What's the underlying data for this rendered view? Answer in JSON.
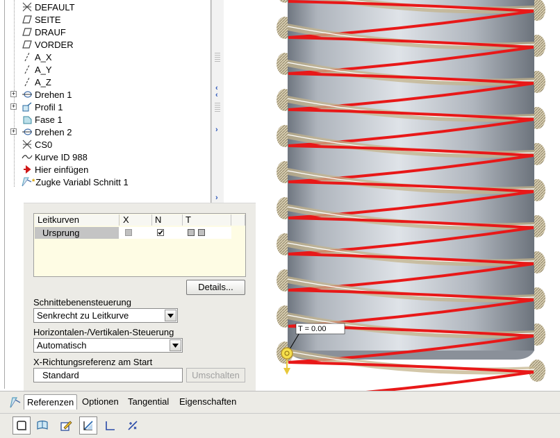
{
  "model_tree": {
    "items": [
      {
        "label": "DEFAULT",
        "icon": "coordinate-system-icon"
      },
      {
        "label": "SEITE",
        "icon": "datum-plane-icon"
      },
      {
        "label": "DRAUF",
        "icon": "datum-plane-icon"
      },
      {
        "label": "VORDER",
        "icon": "datum-plane-icon"
      },
      {
        "label": "A_X",
        "icon": "datum-axis-icon"
      },
      {
        "label": "A_Y",
        "icon": "datum-axis-icon"
      },
      {
        "label": "A_Z",
        "icon": "datum-axis-icon"
      },
      {
        "label": "Drehen 1",
        "icon": "revolve-icon"
      },
      {
        "label": "Profil 1",
        "icon": "sketch-profile-icon"
      },
      {
        "label": "Fase 1",
        "icon": "chamfer-icon"
      },
      {
        "label": "Drehen 2",
        "icon": "revolve-icon"
      },
      {
        "label": "CS0",
        "icon": "coordinate-system-icon"
      },
      {
        "label": "Kurve ID 988",
        "icon": "curve-icon"
      },
      {
        "label": "Hier einfügen",
        "icon": "insert-here-arrow-icon"
      },
      {
        "label": "Zugke Variabl Schnitt 1",
        "icon": "variable-section-sweep-icon"
      }
    ]
  },
  "viewport": {
    "dimension_label": "T = 0.00",
    "colors": {
      "trajectory": "#e81818",
      "cylinder": "#a8aeb6",
      "thread": "#c4b48c"
    }
  },
  "dash": {
    "table": {
      "headers": [
        "Leitkurven",
        "X",
        "N",
        "T"
      ],
      "rows": [
        {
          "name": "Ursprung",
          "x_checked": false,
          "n_checked": true
        }
      ]
    },
    "details_button": "Details...",
    "section_plane_control": {
      "label": "Schnittebenensteuerung",
      "value": "Senkrecht zu Leitkurve"
    },
    "hv_control": {
      "label": "Horizontalen-/Vertikalen-Steuerung",
      "value": "Automatisch"
    },
    "x_direction": {
      "label": "X-Richtungsreferenz am Start",
      "value": "Standard"
    },
    "toggle_button": "Umschalten"
  },
  "tabs": [
    "Referenzen",
    "Optionen",
    "Tangential",
    "Eigenschaften"
  ],
  "active_tab": "Referenzen",
  "toolbar": {
    "icons": [
      "solid-sweep-icon",
      "surface-sweep-icon",
      "edit-section-icon",
      "remove-material-icon",
      "thicken-icon",
      "variable-section-icon"
    ]
  }
}
